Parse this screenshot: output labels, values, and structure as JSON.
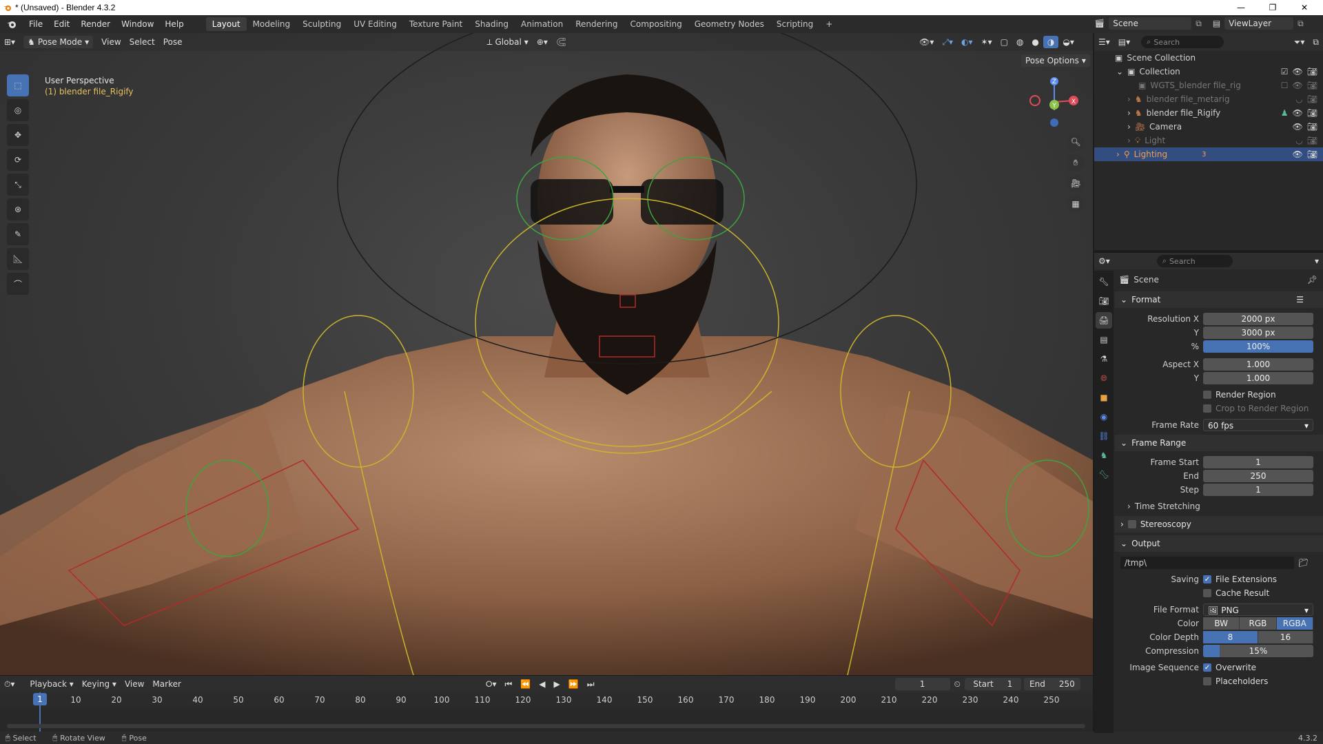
{
  "titlebar": {
    "title": "* (Unsaved) - Blender 4.3.2",
    "minimize": "—",
    "maximize": "❐",
    "close": "✕"
  },
  "menus": [
    "File",
    "Edit",
    "Render",
    "Window",
    "Help"
  ],
  "workspaces": [
    "Layout",
    "Modeling",
    "Sculpting",
    "UV Editing",
    "Texture Paint",
    "Shading",
    "Animation",
    "Rendering",
    "Compositing",
    "Geometry Nodes",
    "Scripting",
    "+"
  ],
  "active_workspace": "Layout",
  "scene_selector": "Scene",
  "viewlayer_selector": "ViewLayer",
  "viewport": {
    "mode": "Pose Mode",
    "menus": [
      "View",
      "Select",
      "Pose"
    ],
    "transform_orientation": "Global",
    "perspective_label": "User Perspective",
    "object_label": "(1) blender file_Rigify",
    "pose_options": "Pose Options",
    "gizmo_axes": {
      "x": "X",
      "y": "Y",
      "z": "Z"
    }
  },
  "outliner": {
    "search_placeholder": "Search",
    "root": "Scene Collection",
    "items": [
      {
        "label": "Collection",
        "depth": 1
      },
      {
        "label": "WGTS_blender file_rig",
        "depth": 2
      },
      {
        "label": "blender file_metarig",
        "depth": 2
      },
      {
        "label": "blender file_Rigify",
        "depth": 2
      },
      {
        "label": "Camera",
        "depth": 2
      },
      {
        "label": "Light",
        "depth": 2
      },
      {
        "label": "Lighting",
        "depth": 1,
        "badge": "3"
      }
    ]
  },
  "properties": {
    "search_placeholder": "Search",
    "context": "Scene",
    "format": {
      "title": "Format",
      "resolution_x_label": "Resolution X",
      "resolution_x": "2000 px",
      "resolution_y_label": "Y",
      "resolution_y": "3000 px",
      "percent_label": "%",
      "percent": "100%",
      "aspect_x_label": "Aspect X",
      "aspect_x": "1.000",
      "aspect_y_label": "Y",
      "aspect_y": "1.000",
      "render_region": "Render Region",
      "crop_region": "Crop to Render Region",
      "frame_rate_label": "Frame Rate",
      "frame_rate": "60 fps"
    },
    "frame_range": {
      "title": "Frame Range",
      "start_label": "Frame Start",
      "start": "1",
      "end_label": "End",
      "end": "250",
      "step_label": "Step",
      "step": "1"
    },
    "time_stretching": "Time Stretching",
    "stereoscopy": "Stereoscopy",
    "output": {
      "title": "Output",
      "path": "/tmp\\",
      "saving_label": "Saving",
      "file_extensions": "File Extensions",
      "cache_result": "Cache Result",
      "file_format_label": "File Format",
      "file_format": "PNG",
      "color_label": "Color",
      "color_options": [
        "BW",
        "RGB",
        "RGBA"
      ],
      "color_depth_label": "Color Depth",
      "depth_options": [
        "8",
        "16"
      ],
      "compression_label": "Compression",
      "compression": "15%",
      "compression_fraction": 0.15,
      "image_sequence_label": "Image Sequence",
      "overwrite": "Overwrite",
      "placeholders": "Placeholders"
    }
  },
  "timeline": {
    "menus": [
      "Playback",
      "Keying",
      "View",
      "Marker"
    ],
    "current_frame": "1",
    "start_label": "Start",
    "start": "1",
    "end_label": "End",
    "end": "250",
    "ticks": [
      "10",
      "20",
      "30",
      "40",
      "50",
      "60",
      "70",
      "80",
      "90",
      "100",
      "110",
      "120",
      "130",
      "140",
      "150",
      "160",
      "170",
      "180",
      "190",
      "200",
      "210",
      "220",
      "230",
      "240",
      "250"
    ],
    "playhead": "1"
  },
  "statusbar": {
    "select": "Select",
    "rotate_view": "Rotate View",
    "pose": "Pose",
    "version": "4.3.2"
  }
}
